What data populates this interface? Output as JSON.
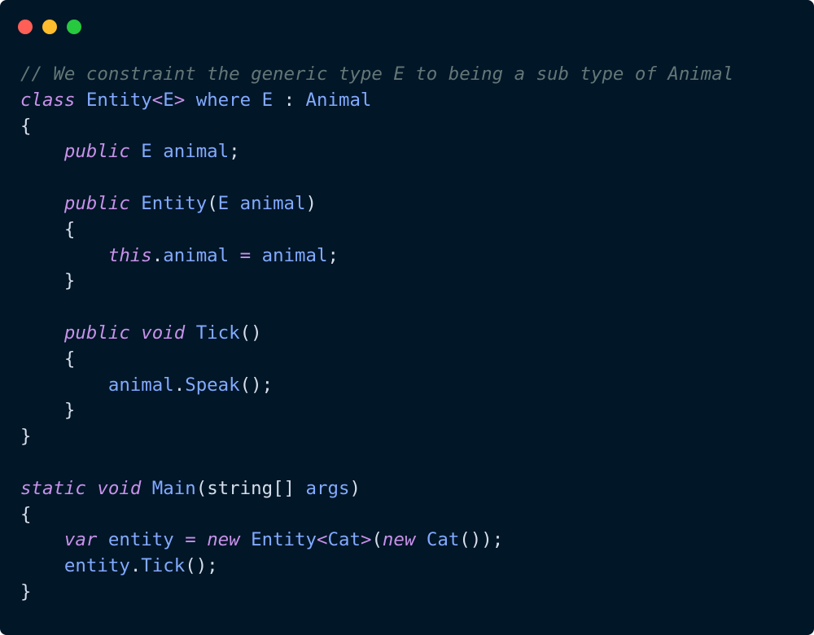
{
  "window": {
    "controls": {
      "close_color": "#ff5f56",
      "minimize_color": "#ffbd2e",
      "maximize_color": "#27c93f"
    },
    "background": "#011627"
  },
  "code": {
    "language": "csharp",
    "lines": [
      [
        {
          "t": "// We constraint the generic type E to being a sub type of Animal",
          "k": "comment"
        }
      ],
      [
        {
          "t": "class",
          "k": "keyword"
        },
        {
          "t": " ",
          "k": "plain"
        },
        {
          "t": "Entity",
          "k": "type"
        },
        {
          "t": "<",
          "k": "op"
        },
        {
          "t": "E",
          "k": "type"
        },
        {
          "t": ">",
          "k": "op"
        },
        {
          "t": " where E ",
          "k": "ident"
        },
        {
          "t": ":",
          "k": "punct"
        },
        {
          "t": " Animal",
          "k": "type"
        }
      ],
      [
        {
          "t": "{",
          "k": "punct"
        }
      ],
      [
        {
          "t": "    ",
          "k": "plain"
        },
        {
          "t": "public",
          "k": "keyword"
        },
        {
          "t": " E animal",
          "k": "ident"
        },
        {
          "t": ";",
          "k": "punct"
        }
      ],
      [
        {
          "t": "",
          "k": "plain"
        }
      ],
      [
        {
          "t": "    ",
          "k": "plain"
        },
        {
          "t": "public",
          "k": "keyword"
        },
        {
          "t": " Entity",
          "k": "ident"
        },
        {
          "t": "(",
          "k": "punct"
        },
        {
          "t": "E animal",
          "k": "ident"
        },
        {
          "t": ")",
          "k": "punct"
        }
      ],
      [
        {
          "t": "    {",
          "k": "punct"
        }
      ],
      [
        {
          "t": "        ",
          "k": "plain"
        },
        {
          "t": "this",
          "k": "keyword"
        },
        {
          "t": ".",
          "k": "punct"
        },
        {
          "t": "animal ",
          "k": "ident"
        },
        {
          "t": "=",
          "k": "op"
        },
        {
          "t": " animal",
          "k": "ident"
        },
        {
          "t": ";",
          "k": "punct"
        }
      ],
      [
        {
          "t": "    }",
          "k": "punct"
        }
      ],
      [
        {
          "t": "",
          "k": "plain"
        }
      ],
      [
        {
          "t": "    ",
          "k": "plain"
        },
        {
          "t": "public",
          "k": "keyword"
        },
        {
          "t": " ",
          "k": "plain"
        },
        {
          "t": "void",
          "k": "keyword"
        },
        {
          "t": " Tick",
          "k": "ident"
        },
        {
          "t": "()",
          "k": "punct"
        }
      ],
      [
        {
          "t": "    {",
          "k": "punct"
        }
      ],
      [
        {
          "t": "        ",
          "k": "plain"
        },
        {
          "t": "animal",
          "k": "ident"
        },
        {
          "t": ".",
          "k": "punct"
        },
        {
          "t": "Speak",
          "k": "ident"
        },
        {
          "t": "();",
          "k": "punct"
        }
      ],
      [
        {
          "t": "    }",
          "k": "punct"
        }
      ],
      [
        {
          "t": "}",
          "k": "punct"
        }
      ],
      [
        {
          "t": "",
          "k": "plain"
        }
      ],
      [
        {
          "t": "static",
          "k": "keyword"
        },
        {
          "t": " ",
          "k": "plain"
        },
        {
          "t": "void",
          "k": "keyword"
        },
        {
          "t": " Main",
          "k": "ident"
        },
        {
          "t": "(",
          "k": "punct"
        },
        {
          "t": "string[]",
          "k": "plain"
        },
        {
          "t": " args",
          "k": "ident"
        },
        {
          "t": ")",
          "k": "punct"
        }
      ],
      [
        {
          "t": "{",
          "k": "punct"
        }
      ],
      [
        {
          "t": "    ",
          "k": "plain"
        },
        {
          "t": "var",
          "k": "keyword"
        },
        {
          "t": " entity ",
          "k": "ident"
        },
        {
          "t": "=",
          "k": "op"
        },
        {
          "t": " ",
          "k": "plain"
        },
        {
          "t": "new",
          "k": "keyword"
        },
        {
          "t": " Entity",
          "k": "ident"
        },
        {
          "t": "<",
          "k": "op"
        },
        {
          "t": "Cat",
          "k": "type"
        },
        {
          "t": ">",
          "k": "op"
        },
        {
          "t": "(",
          "k": "punct"
        },
        {
          "t": "new",
          "k": "keyword"
        },
        {
          "t": " Cat",
          "k": "ident"
        },
        {
          "t": "());",
          "k": "punct"
        }
      ],
      [
        {
          "t": "    ",
          "k": "plain"
        },
        {
          "t": "entity",
          "k": "ident"
        },
        {
          "t": ".",
          "k": "punct"
        },
        {
          "t": "Tick",
          "k": "ident"
        },
        {
          "t": "();",
          "k": "punct"
        }
      ],
      [
        {
          "t": "}",
          "k": "punct"
        }
      ]
    ]
  }
}
